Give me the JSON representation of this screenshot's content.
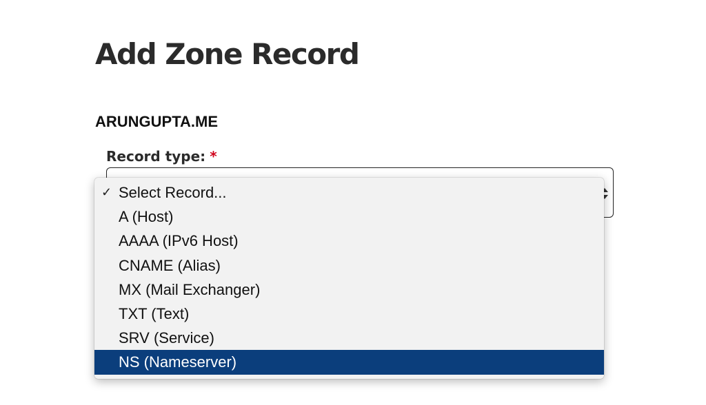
{
  "page": {
    "title": "Add Zone Record",
    "domain": "ARUNGUPTA.ME"
  },
  "record_type": {
    "label": "Record type:",
    "required_marker": "*",
    "current_value": "Select Record...",
    "options": [
      {
        "label": "Select Record...",
        "checked": true,
        "highlighted": false
      },
      {
        "label": "A (Host)",
        "checked": false,
        "highlighted": false
      },
      {
        "label": "AAAA (IPv6 Host)",
        "checked": false,
        "highlighted": false
      },
      {
        "label": "CNAME (Alias)",
        "checked": false,
        "highlighted": false
      },
      {
        "label": "MX (Mail Exchanger)",
        "checked": false,
        "highlighted": false
      },
      {
        "label": "TXT (Text)",
        "checked": false,
        "highlighted": false
      },
      {
        "label": "SRV (Service)",
        "checked": false,
        "highlighted": false
      },
      {
        "label": "NS (Nameserver)",
        "checked": false,
        "highlighted": true
      }
    ],
    "check_glyph": "✓",
    "highlight_color": "#0b3e7c",
    "required_color": "#d0021b"
  }
}
